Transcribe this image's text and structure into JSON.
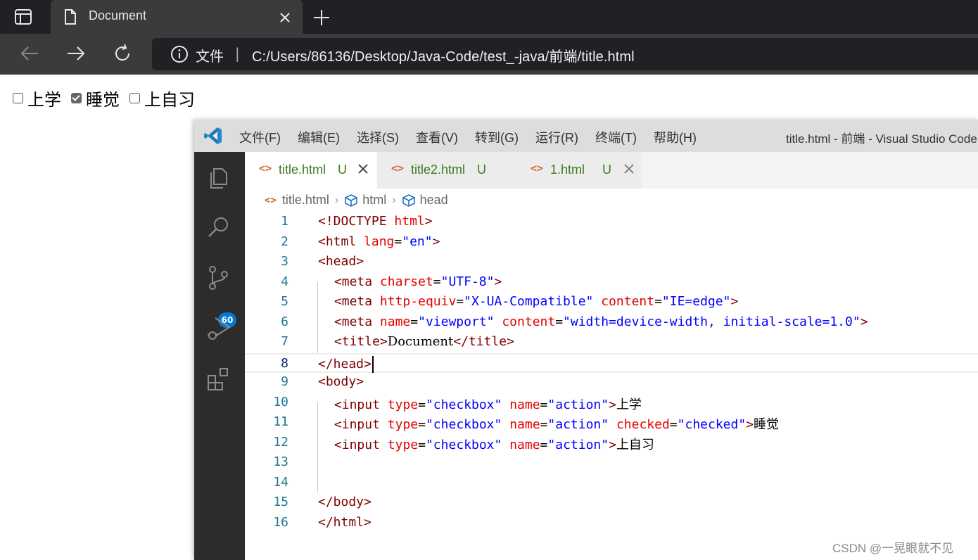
{
  "browser": {
    "tab_title": "Document",
    "address_label": "文件",
    "address_separator": "|",
    "url": "C:/Users/86136/Desktop/Java-Code/test_-java/前端/title.html"
  },
  "page": {
    "checkboxes": [
      {
        "label": "上学",
        "checked": false
      },
      {
        "label": "睡觉",
        "checked": true
      },
      {
        "label": "上自习",
        "checked": false
      }
    ]
  },
  "vscode": {
    "menu": [
      "文件(F)",
      "编辑(E)",
      "选择(S)",
      "查看(V)",
      "转到(G)",
      "运行(R)",
      "终端(T)",
      "帮助(H)"
    ],
    "window_title": "title.html - 前端 - Visual Studio Code",
    "scm_badge": "60",
    "tabs": [
      {
        "icon": "<>",
        "name": "title.html",
        "status": "U",
        "active": true
      },
      {
        "icon": "<>",
        "name": "title2.html",
        "status": "U",
        "active": false
      },
      {
        "icon": "<>",
        "name": "1.html",
        "status": "U",
        "active": false
      }
    ],
    "breadcrumb": [
      "title.html",
      "html",
      "head"
    ],
    "lines": [
      {
        "n": "1",
        "code": "<!DOCTYPE html>"
      },
      {
        "n": "2",
        "code": "<html lang=\"en\">"
      },
      {
        "n": "3",
        "code": "<head>"
      },
      {
        "n": "4",
        "code": "    <meta charset=\"UTF-8\">"
      },
      {
        "n": "5",
        "code": "    <meta http-equiv=\"X-UA-Compatible\" content=\"IE=edge\">"
      },
      {
        "n": "6",
        "code": "    <meta name=\"viewport\" content=\"width=device-width, initial-scale=1.0\">"
      },
      {
        "n": "7",
        "code": "    <title>Document</title>"
      },
      {
        "n": "8",
        "code": "</head>"
      },
      {
        "n": "9",
        "code": "<body>"
      },
      {
        "n": "10",
        "code": "    <input type=\"checkbox\" name=\"action\">上学"
      },
      {
        "n": "11",
        "code": "    <input type=\"checkbox\" name=\"action\" checked=\"checked\">睡觉"
      },
      {
        "n": "12",
        "code": "    <input type=\"checkbox\" name=\"action\">上自习"
      },
      {
        "n": "13",
        "code": ""
      },
      {
        "n": "14",
        "code": ""
      },
      {
        "n": "15",
        "code": "</body>"
      },
      {
        "n": "16",
        "code": "</html>"
      }
    ],
    "current_line": "8"
  },
  "watermark": "CSDN @一晃眼就不见",
  "colors": {
    "tag": "#800000",
    "attribute": "#e50000",
    "value": "#0000ff",
    "line_number": "#237893",
    "git_untracked": "#3c7a1e",
    "badge": "#0078d4"
  }
}
